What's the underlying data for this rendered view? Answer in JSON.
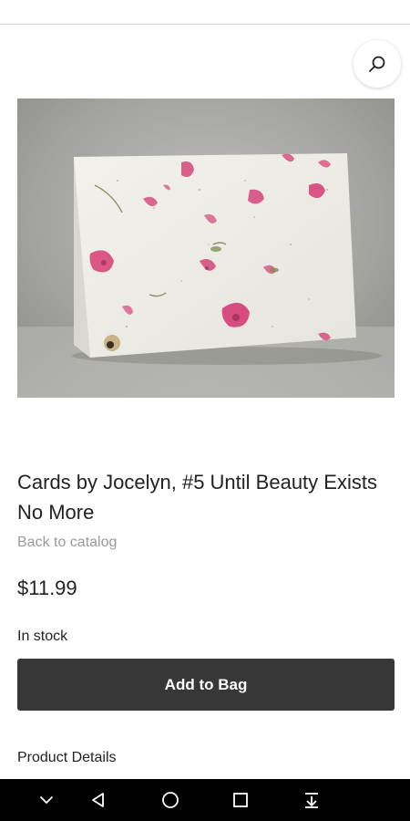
{
  "header": {
    "search_icon": "search-icon"
  },
  "product": {
    "image_alt": "Handmade seed paper greeting card with pressed pink flower petals",
    "title": "Cards by Jocelyn, #5 Until Beauty Exists No More",
    "back_link": "Back to catalog",
    "price": "$11.99",
    "stock_status": "In stock",
    "add_to_bag_label": "Add to Bag",
    "details_heading": "Product Details"
  },
  "colors": {
    "button_bg": "#373737",
    "muted_text": "#9a9a9a",
    "nav_bar_bg": "#000000"
  },
  "system_nav": {
    "icons": [
      "chevron-down-icon",
      "back-triangle-icon",
      "home-circle-icon",
      "recents-square-icon",
      "notification-pull-icon"
    ]
  }
}
